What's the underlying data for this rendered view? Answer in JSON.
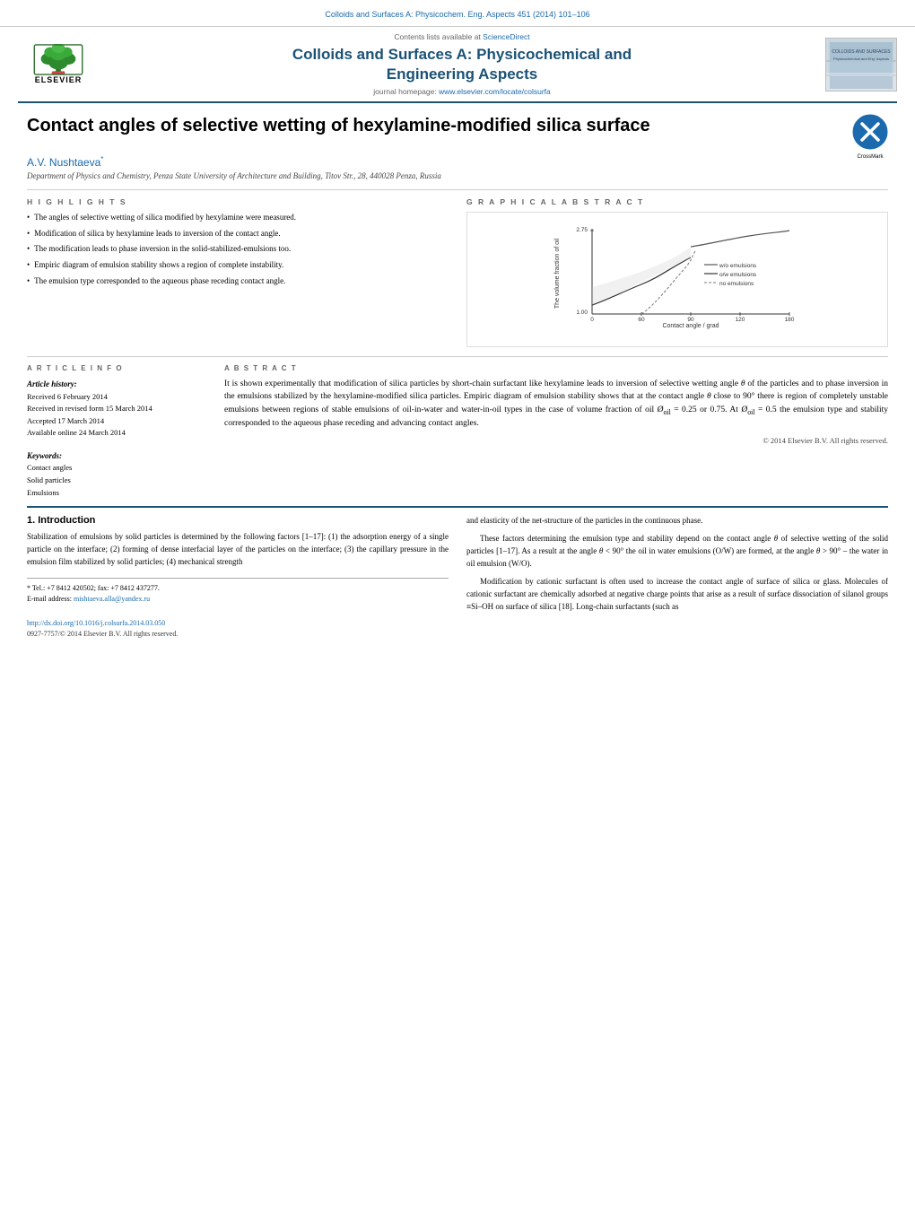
{
  "header": {
    "top_link_text": "Colloids and Surfaces A: Physicochem. Eng. Aspects 451 (2014) 101–106",
    "contents_prefix": "Contents lists available at ",
    "contents_link_text": "ScienceDirect",
    "journal_main_title": "Colloids and Surfaces A: Physicochemical and\nEngineering Aspects",
    "homepage_prefix": "journal homepage: ",
    "homepage_link": "www.elsevier.com/locate/colsurfa",
    "elsevier_label": "ELSEVIER"
  },
  "article": {
    "title": "Contact angles of selective wetting of hexylamine-modified silica surface",
    "crossmark_label": "CrossMark",
    "author": "A.V. Nushtaeva",
    "author_sup": "*",
    "affiliation": "Department of Physics and Chemistry, Penza State University of Architecture and Building, Titov Str., 28, 440028 Penza, Russia"
  },
  "highlights": {
    "section_label": "H I G H L I G H T S",
    "items": [
      "The angles of selective wetting of silica modified by hexylamine were measured.",
      "Modification of silica by hexylamine leads to inversion of the contact angle.",
      "The modification leads to phase inversion in the solid-stabilized-emulsions too.",
      "Empiric diagram of emulsion stability shows a region of complete instability.",
      "The emulsion type corresponded to the aqueous phase receding contact angle."
    ]
  },
  "graphical_abstract": {
    "section_label": "G R A P H I C A L   A B S T R A C T",
    "y_axis_label": "The volume fraction of oil",
    "x_axis_label": "Contact angle / grad",
    "legend": {
      "wo_emulsions": "w/o emulsions",
      "ow_emulsions": "o/w emulsions",
      "no_emulsions": "no emulsions"
    },
    "y_max": "2.75",
    "y_min": "1.00",
    "x_min": "0",
    "x_max": "180"
  },
  "article_info": {
    "section_label": "A R T I C L E   I N F O",
    "history_title": "Article history:",
    "received": "Received 6 February 2014",
    "received_revised": "Received in revised form 15 March 2014",
    "accepted": "Accepted 17 March 2014",
    "available": "Available online 24 March 2014",
    "keywords_title": "Keywords:",
    "keyword1": "Contact angles",
    "keyword2": "Solid particles",
    "keyword3": "Emulsions"
  },
  "abstract": {
    "section_label": "A B S T R A C T",
    "text": "It is shown experimentally that modification of silica particles by short-chain surfactant like hexylamine leads to inversion of selective wetting angle θ of the particles and to phase inversion in the emulsions stabilized by the hexylamine-modified silica particles. Empiric diagram of emulsion stability shows that at the contact angle θ close to 90° there is region of completely unstable emulsions between regions of stable emulsions of oil-in-water and water-in-oil types in the case of volume fraction of oil Øoil = 0.25 or 0.75. At Øoil = 0.5 the emulsion type and stability corresponded to the aqueous phase receding and advancing contact angles.",
    "copyright": "© 2014 Elsevier B.V. All rights reserved."
  },
  "section1": {
    "title": "1.  Introduction",
    "col_left_para1": "Stabilization of emulsions by solid particles is determined by the following factors [1–17]: (1) the adsorption energy of a single particle on the interface; (2) forming of dense interfacial layer of the particles on the interface; (3) the capillary pressure in the emulsion film stabilized by solid particles; (4) mechanical strength",
    "col_right_para1": "and elasticity of the net-structure of the particles in the continuous phase.",
    "col_right_para2": "These factors determining the emulsion type and stability depend on the contact angle θ of selective wetting of the solid particles [1–17]. As a result at the angle θ < 90° the oil in water emulsions (O/W) are formed, at the angle θ > 90° – the water in oil emulsion (W/O).",
    "col_right_para3": "Modification by cationic surfactant is often used to increase the contact angle of surface of silica or glass. Molecules of cationic surfactant are chemically adsorbed at negative charge points that arise as a result of surface dissociation of silanol groups ≡Si–OH on surface of silica [18]. Long-chain surfactants (such as"
  },
  "footnote": {
    "note": "* Tel.: +7 8412 420502; fax: +7 8412 437277.",
    "email_label": "E-mail address: ",
    "email": "mishtaeva.alla@yandex.ru",
    "doi_line": "http://dx.doi.org/10.1016/j.colsurfa.2014.03.050",
    "issn_line": "0927-7757/© 2014 Elsevier B.V. All rights reserved."
  }
}
